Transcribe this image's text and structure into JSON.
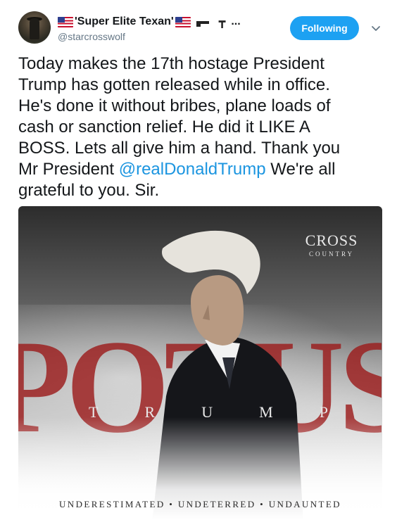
{
  "tweet": {
    "display_name": "'Super Elite Texan'",
    "handle": "@starcrosswolf",
    "more_glyph": "...",
    "extra_glyph": "┳",
    "follow_label": "Following",
    "text_lines": [
      "Today makes the 17th hostage President",
      "Trump has gotten released while in office.",
      "He's done it without bribes, plane loads of",
      "cash or sanction relief. He did it LIKE A",
      "BOSS. Lets all give him a hand. Thank you"
    ],
    "line6_before": "Mr President ",
    "mention": "@realDonaldTrump",
    "line6_after": " We're all",
    "line7": "grateful to you.  Sir.",
    "icons": {
      "flag": "us-flag-icon",
      "weapon": "rifle-icon",
      "caret": "chevron-down-icon"
    }
  },
  "media": {
    "potus_word": "POTUS",
    "brand_main": "CROSS",
    "brand_sub": "COUNTRY",
    "name_letters": [
      "T",
      "R",
      "U",
      "M",
      "P"
    ],
    "tagline": "UNDERESTIMATED  •  UNDETERRED  •  UNDAUNTED"
  },
  "colors": {
    "follow_button": "#1da1f2",
    "mention": "#1b95e0",
    "potus_red": "#9b1c1c",
    "text": "#14171a",
    "handle": "#657786"
  }
}
